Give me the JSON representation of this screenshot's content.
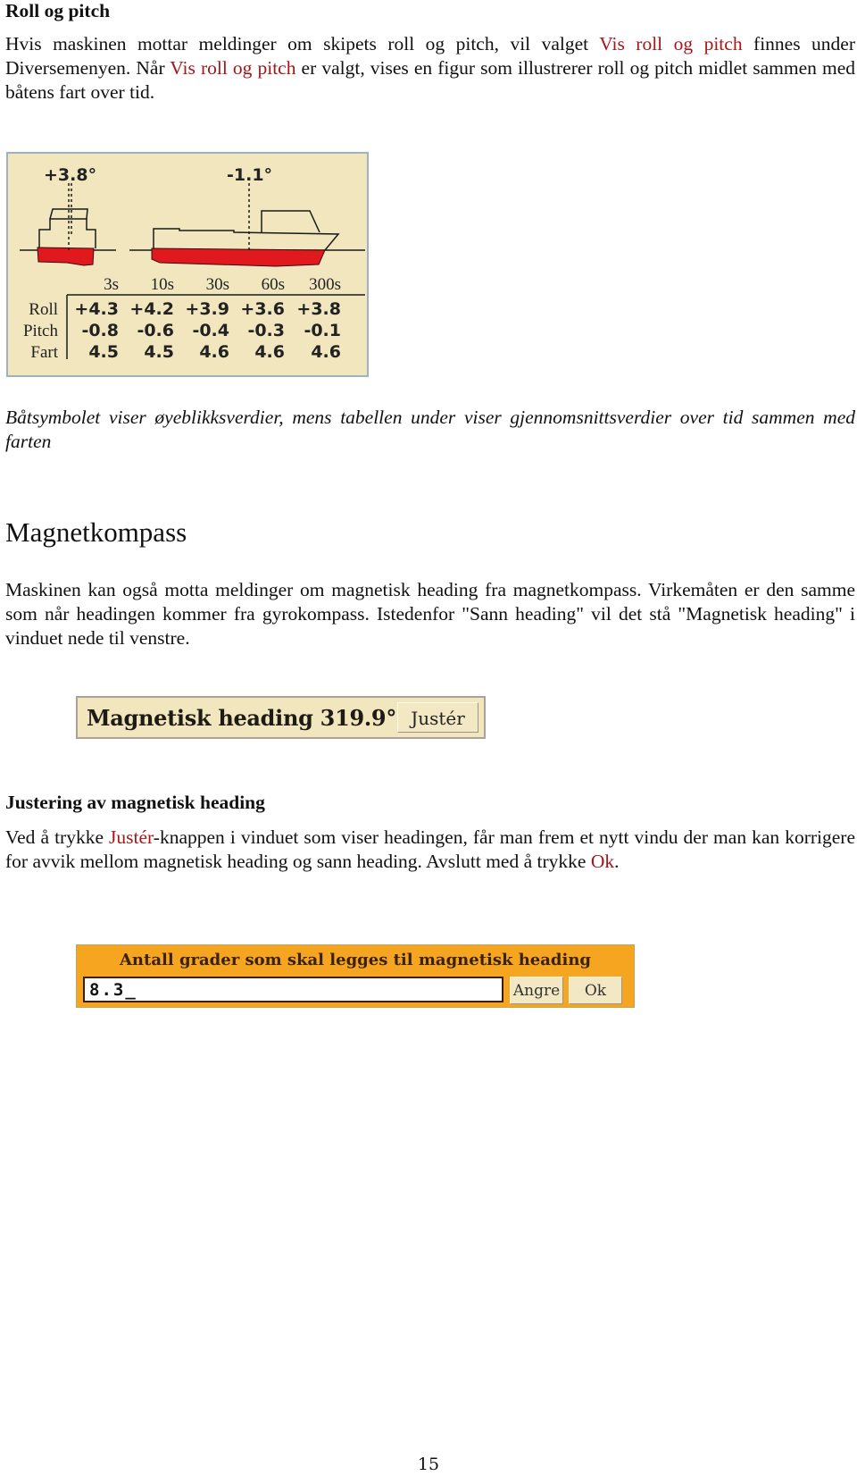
{
  "section1": {
    "title": "Roll og pitch",
    "para": [
      {
        "text": "Hvis maskinen mottar meldinger om skipets roll og pitch, vil valget "
      },
      {
        "text": "Vis roll og pitch",
        "highlight": true
      },
      {
        "text": " finnes under Diversemenyen. Når "
      },
      {
        "text": "Vis roll og pitch",
        "highlight": true
      },
      {
        "text": " er valgt, vises en figur som illustrerer roll og pitch midlet sammen med båtens fart over tid."
      }
    ]
  },
  "roll_pitch_widget": {
    "roll_angle_label": "+3.8°",
    "pitch_angle_label": "-1.1°",
    "roll_angle": 3.8,
    "pitch_angle": -1.1,
    "columns": [
      "3s",
      "10s",
      "30s",
      "60s",
      "300s"
    ],
    "rows": [
      {
        "label": "Roll",
        "values": [
          "+4.3",
          "+4.2",
          "+3.9",
          "+3.6",
          "+3.8"
        ]
      },
      {
        "label": "Pitch",
        "values": [
          "-0.8",
          "-0.6",
          "-0.4",
          "-0.3",
          "-0.1"
        ]
      },
      {
        "label": "Fart",
        "values": [
          "4.5",
          "4.5",
          "4.6",
          "4.6",
          "4.6"
        ]
      }
    ],
    "colors": {
      "background": "#f2e6bf",
      "hull": "#e0191f",
      "line": "#1a1a1a"
    }
  },
  "caption": "Båtsymbolet viser øyeblikksverdier, mens tabellen under viser gjennomsnittsverdier over tid sammen med farten",
  "section2": {
    "title": "Magnetkompass",
    "para": "Maskinen kan også motta meldinger om magnetisk heading fra magnetkompass. Virkemåten er den samme som når headingen kommer fra gyrokompass. Istedenfor \"Sann heading\" vil det stå \"Magnetisk heading\" i vinduet nede til venstre."
  },
  "heading_widget": {
    "label": "Magnetisk heading 319.9°",
    "button_label": "Justér"
  },
  "section3": {
    "title": "Justering av magnetisk heading",
    "para": [
      {
        "text": "Ved å trykke "
      },
      {
        "text": "Justér",
        "highlight": true
      },
      {
        "text": "-knappen i vinduet som viser headingen, får man frem et nytt vindu der man kan korrigere for avvik mellom magnetisk heading og sann heading. Avslutt med å trykke "
      },
      {
        "text": "Ok",
        "highlight": true
      },
      {
        "text": "."
      }
    ]
  },
  "dialog": {
    "title": "Antall grader som skal legges til magnetisk heading",
    "input_value": "8.3_",
    "cancel_label": "Angre",
    "ok_label": "Ok",
    "color": "#f6a521"
  },
  "page_number": "15",
  "colors": {
    "highlight_text": "#a3161a"
  }
}
